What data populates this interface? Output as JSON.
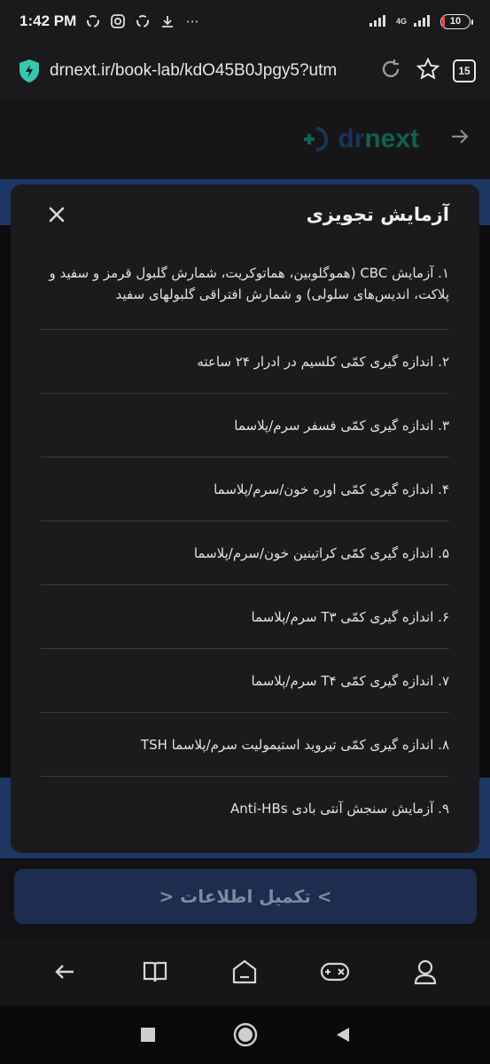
{
  "status_bar": {
    "time": "1:42 PM",
    "network": "4G",
    "battery": "10",
    "battery_level": 0.1
  },
  "browser": {
    "url": "drnext.ir/book-lab/kdO45B0Jpgy5?utm",
    "tab_count": "15"
  },
  "site": {
    "logo_text_prefix": "dr",
    "logo_text_suffix": "next",
    "accent_color": "#0e9f78",
    "brand_blue": "#1d3764"
  },
  "modal": {
    "title": "آزمایش تجویزی",
    "tests": [
      "۱. آزمایش CBC (هموگلوبین، هماتوکریت، شمارش گلبول قرمز و سفید و پلاکت، اندیس‌های سلولی) و شمارش افتراقی گلبولهای سفید",
      "۲. اندازه گیری کمّی کلسیم در ادرار ۲۴ ساعته",
      "۳. اندازه گیری کمّی فسفر سرم/پلاسما",
      "۴. اندازه گیری کمّی اوره خون/سرم/پلاسما",
      "۵. اندازه گیری کمّی کراتینین خون/سرم/پلاسما",
      "۶. اندازه گیری کمّی T۳ سرم/پلاسما",
      "۷.  اندازه گیری کمّی T۴ سرم/پلاسما",
      "۸. اندازه گیری کمّی تیروید استیمولیت سرم/پلاسما TSH",
      "۹. آزمایش سنجش آنتی بادی Anti-HBs"
    ]
  },
  "footer": {
    "complete_button": "> تکمیل اطلاعات <"
  }
}
